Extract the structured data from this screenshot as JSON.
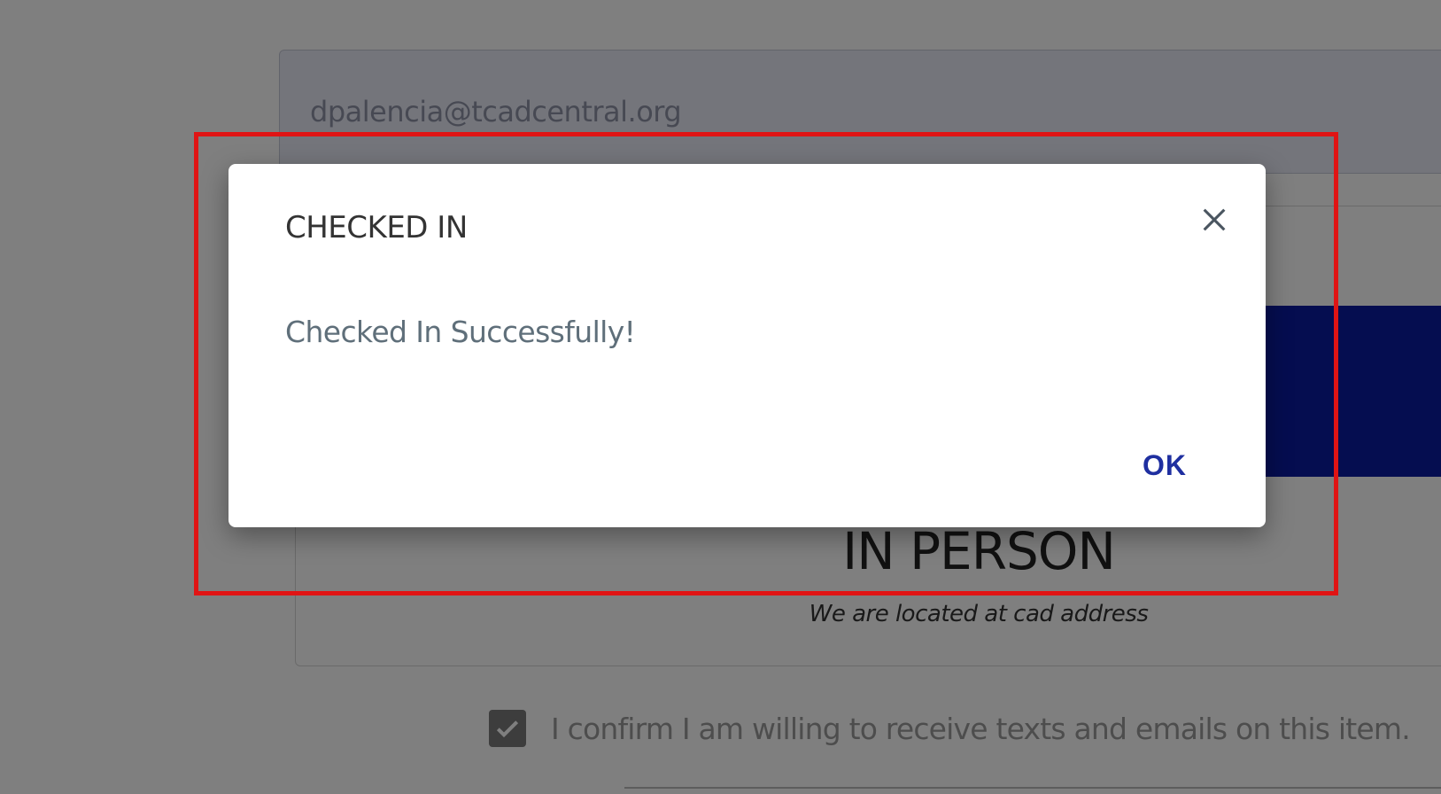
{
  "form": {
    "email_value": "dpalencia@tcadcentral.org",
    "attendance_mode_title": "IN PERSON",
    "attendance_mode_subtitle": "We are located at cad address",
    "consent_label": "I confirm I am willing to receive texts and emails on this item.",
    "consent_checked": true
  },
  "dialog": {
    "title": "CHECKED IN",
    "message": "Checked In Successfully!",
    "ok_label": "OK",
    "close_icon": "close-icon"
  },
  "colors": {
    "highlight": "#e01414",
    "primary": "#1f2fa0",
    "banner": "#0a1aa0"
  }
}
